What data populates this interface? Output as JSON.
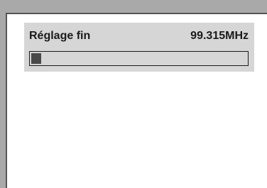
{
  "tuning": {
    "label": "Réglage fin",
    "frequency": "99.315MHz",
    "level": 0.045
  },
  "colors": {
    "panel": "#d6d6d6",
    "bar_fill": "#4a4a4a",
    "text": "#1a1a1a",
    "screen": "#ffffff",
    "outer": "#a9a9a9"
  }
}
